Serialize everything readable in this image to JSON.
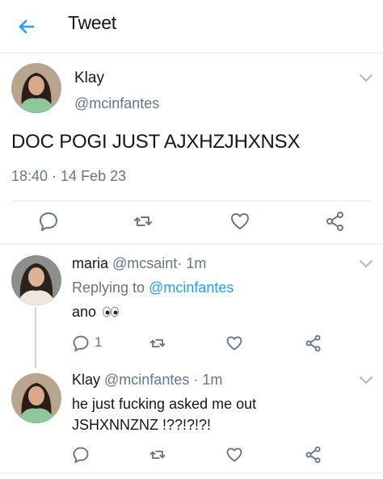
{
  "header": {
    "title": "Tweet",
    "back_icon": "back-arrow-icon"
  },
  "main_tweet": {
    "name": "Klay",
    "handle": "@mcinfantes",
    "text": "DOC POGI JUST AJXHZJHXNSX",
    "timestamp": "18:40 · 14 Feb 23"
  },
  "replies": [
    {
      "name": "maria",
      "handle": "@mcsaint",
      "dot": "·",
      "ago": "1m",
      "replying_prefix": "Replying to",
      "replying_to": "@mcinfantes",
      "text": "ano",
      "emoji": "eyes-emoji",
      "reply_count": "1"
    },
    {
      "name": "Klay",
      "handle": "@mcinfantes",
      "dot": "·",
      "ago": "1m",
      "text_line1": "he just fucking asked me out",
      "text_line2": "JSHXNNZNZ !??!?!?!"
    }
  ],
  "icons": [
    "reply-icon",
    "retweet-icon",
    "like-icon",
    "share-icon",
    "chevron-down-icon"
  ],
  "colors": {
    "accent": "#1da1f2",
    "secondary_text": "#657786",
    "divider": "#e6ecf0",
    "icon_gray": "#657786"
  }
}
